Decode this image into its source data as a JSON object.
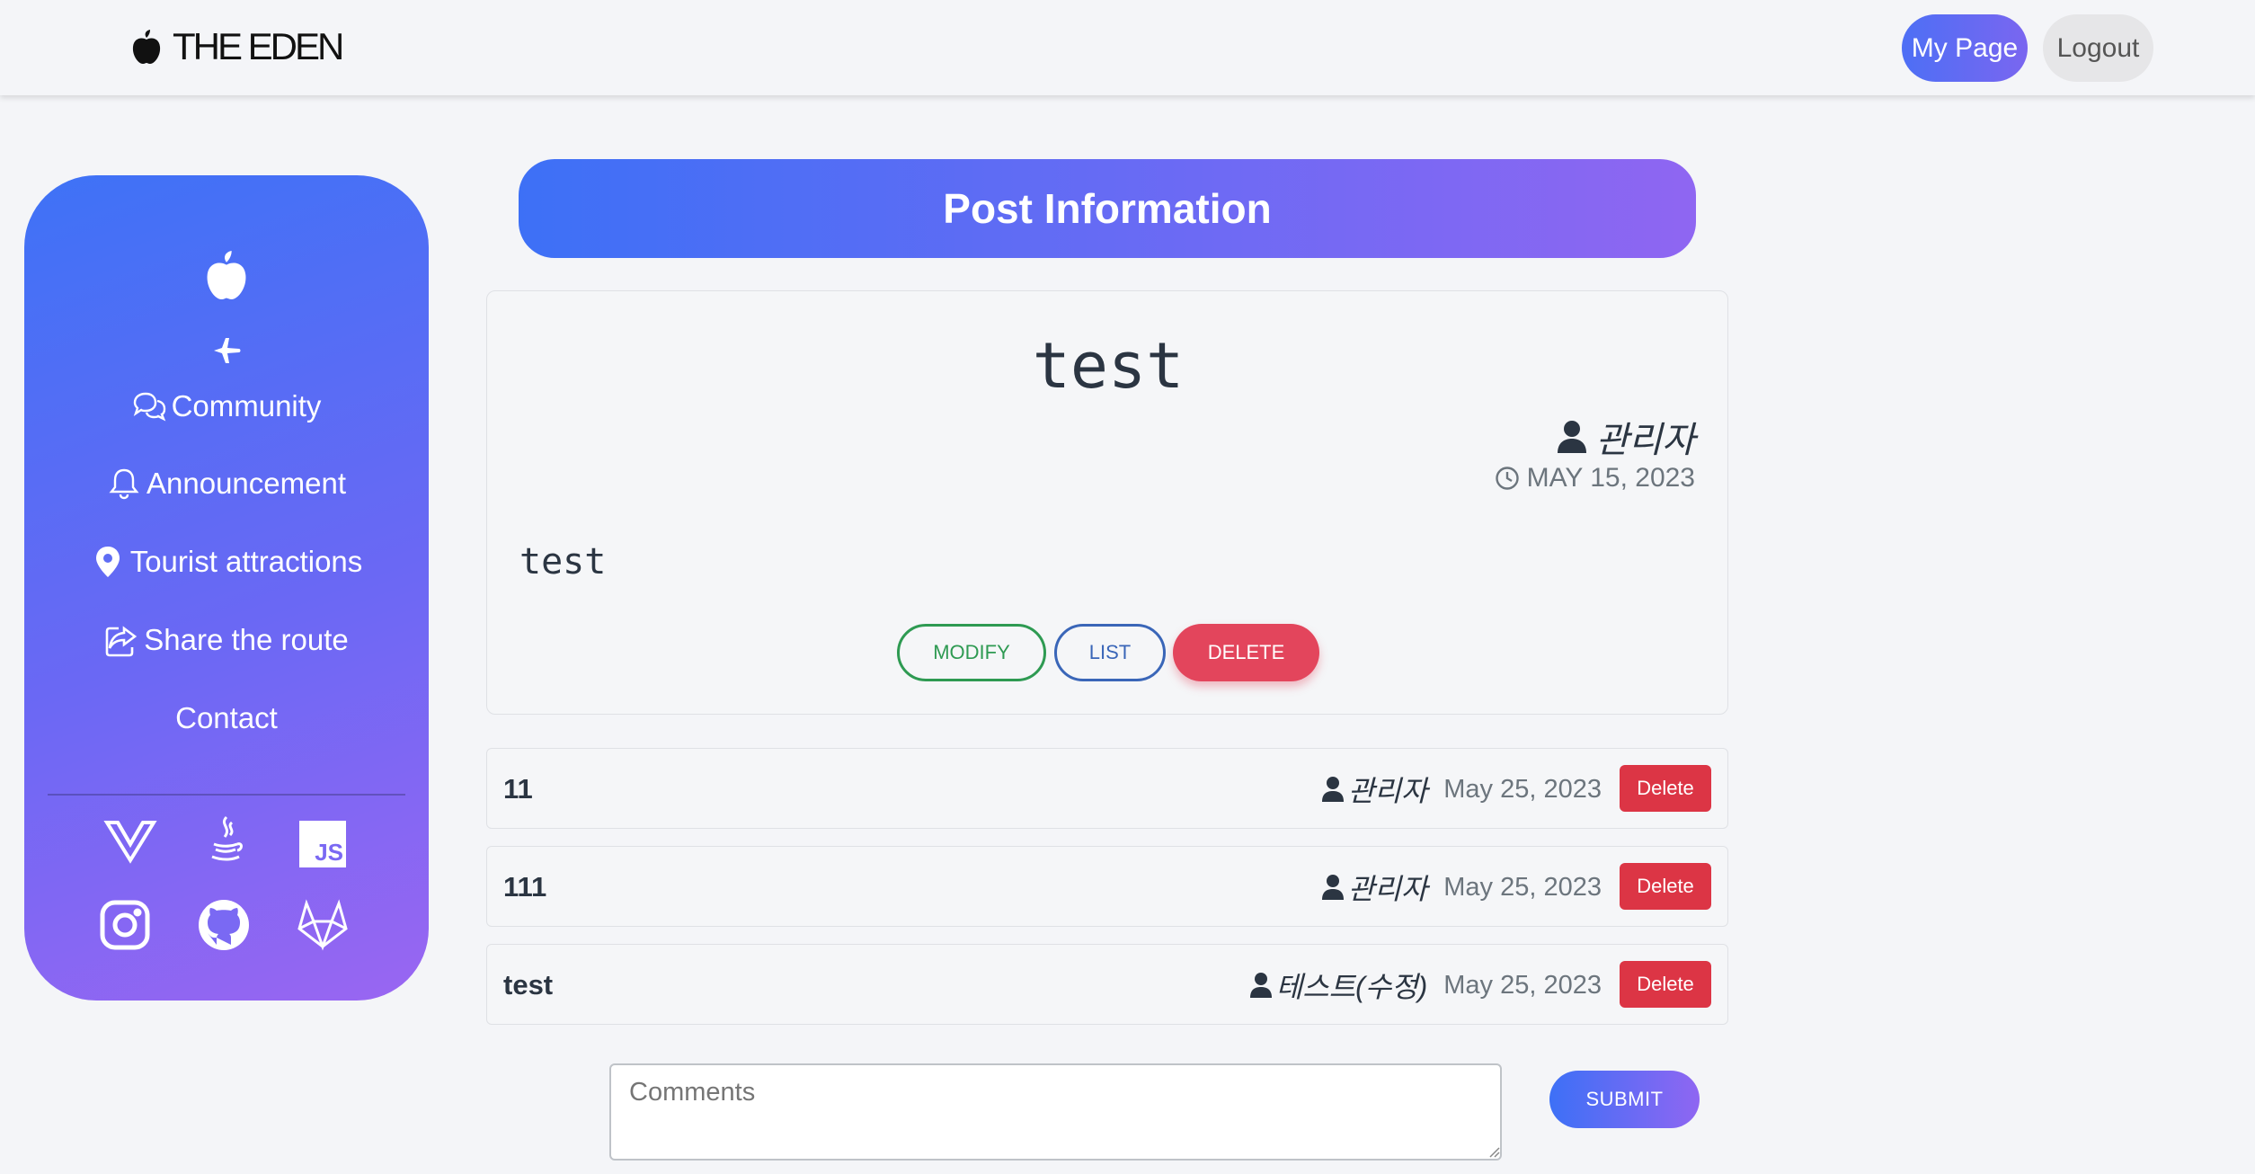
{
  "header": {
    "brand": "THE EDEN",
    "brand_icon": "apple-icon",
    "mypage_label": "My Page",
    "logout_label": "Logout"
  },
  "sidebar": {
    "top_icons": [
      "apple-icon",
      "plane-icon"
    ],
    "items": [
      {
        "label": "Community",
        "icon": "chat-icon"
      },
      {
        "label": "Announcement",
        "icon": "bell-icon"
      },
      {
        "label": "Tourist attractions",
        "icon": "map-pin-icon"
      },
      {
        "label": "Share the route",
        "icon": "share-icon"
      },
      {
        "label": "Contact",
        "icon": ""
      }
    ],
    "social_icons": [
      "vue-icon",
      "java-icon",
      "js-icon",
      "instagram-icon",
      "github-icon",
      "gitlab-icon"
    ],
    "js_text": "JS"
  },
  "page": {
    "heading": "Post Information"
  },
  "post": {
    "title": "test",
    "author": "관리자",
    "date": "MAY 15, 2023",
    "body": "test",
    "modify_label": "MODIFY",
    "list_label": "LIST",
    "delete_label": "DELETE"
  },
  "comments": [
    {
      "text": "11",
      "author": "관리자",
      "date": "May 25, 2023",
      "delete_label": "Delete"
    },
    {
      "text": "111",
      "author": "관리자",
      "date": "May 25, 2023",
      "delete_label": "Delete"
    },
    {
      "text": "test",
      "author": "테스트(수정)",
      "date": "May 25, 2023",
      "delete_label": "Delete"
    }
  ],
  "comment_form": {
    "placeholder": "Comments",
    "value": "",
    "submit_label": "SUBMIT"
  },
  "colors": {
    "accent_start": "#3d70f6",
    "accent_end": "#8f66f2",
    "delete_red": "#dc3545",
    "modify_green": "#2e9a52",
    "list_blue": "#3a66b8"
  }
}
